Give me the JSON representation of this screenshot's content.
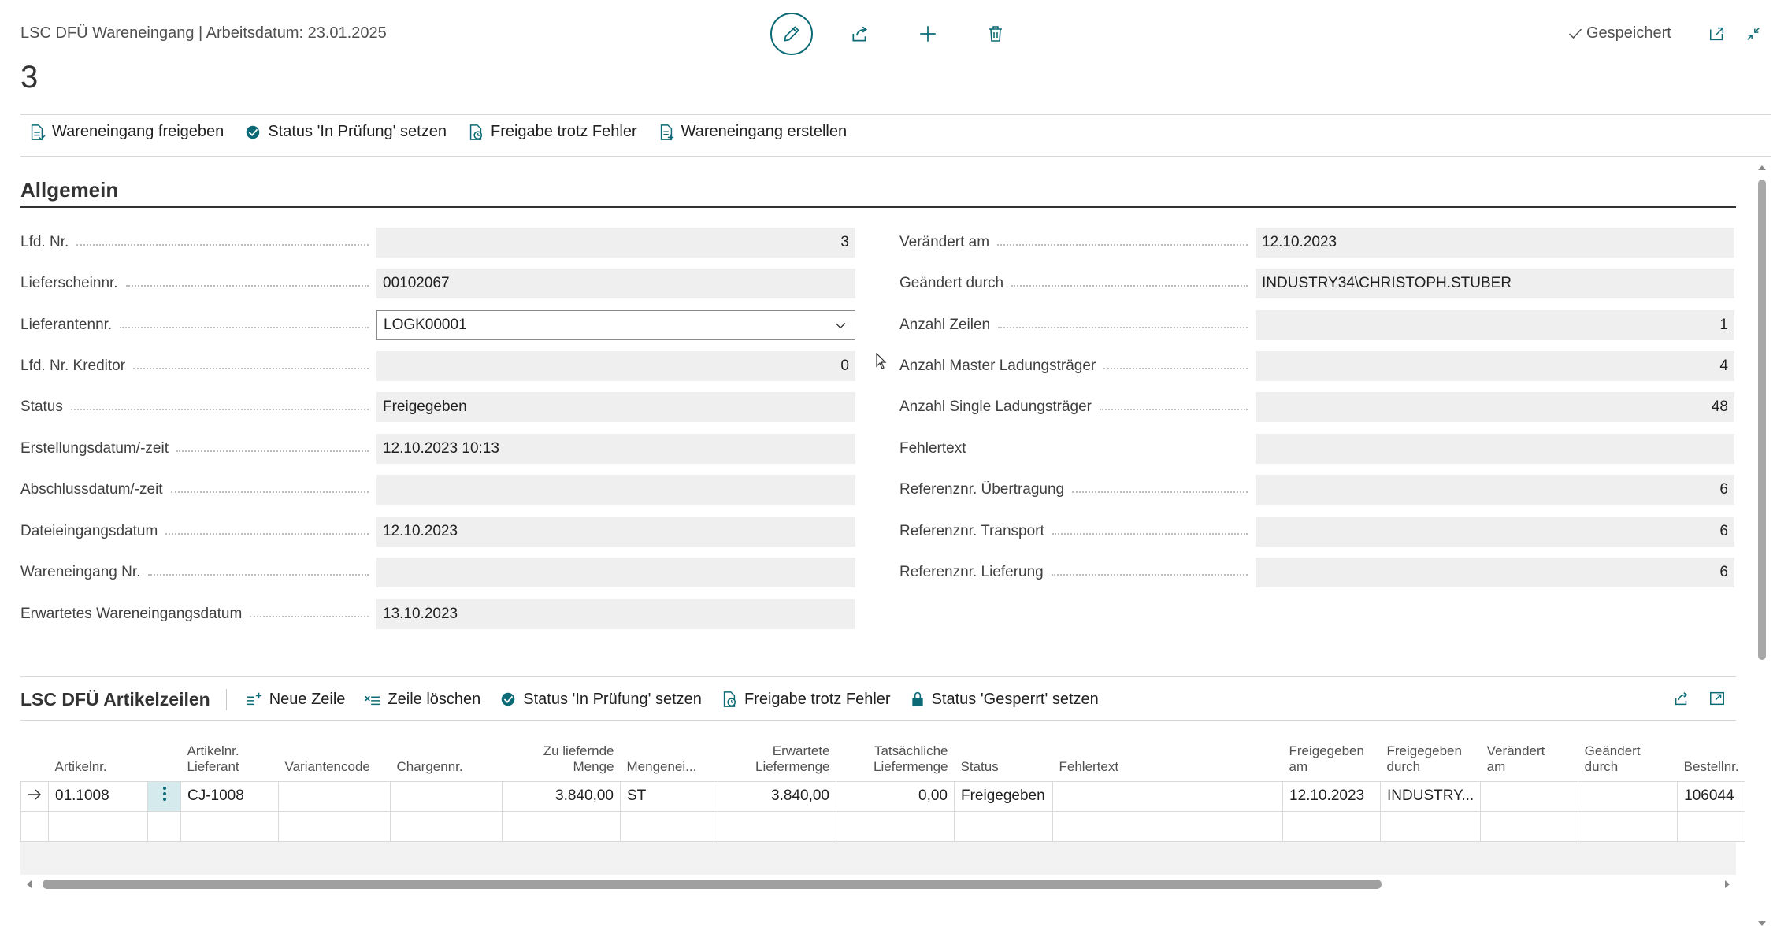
{
  "header": {
    "caption": "LSC DFÜ Wareneingang | Arbeitsdatum: 23.01.2025",
    "record_no": "3",
    "saved_label": "Gespeichert"
  },
  "actions": [
    {
      "label": "Wareneingang freigeben",
      "icon": "document-release-icon"
    },
    {
      "label": "Status 'In Prüfung' setzen",
      "icon": "check-badge-icon"
    },
    {
      "label": "Freigabe trotz Fehler",
      "icon": "document-warning-icon"
    },
    {
      "label": "Wareneingang erstellen",
      "icon": "document-create-icon"
    }
  ],
  "section": {
    "title": "Allgemein",
    "left_fields": [
      {
        "label": "Lfd. Nr.",
        "value": "3"
      },
      {
        "label": "Lieferscheinnr.",
        "value": "00102067"
      },
      {
        "label": "Lieferantennr.",
        "value": "LOGK00001"
      },
      {
        "label": "Lfd. Nr. Kreditor",
        "value": "0"
      },
      {
        "label": "Status",
        "value": "Freigegeben"
      },
      {
        "label": "Erstellungsdatum/-zeit",
        "value": "12.10.2023 10:13"
      },
      {
        "label": "Abschlussdatum/-zeit",
        "value": ""
      },
      {
        "label": "Dateieingangsdatum",
        "value": "12.10.2023"
      },
      {
        "label": "Wareneingang Nr.",
        "value": ""
      },
      {
        "label": "Erwartetes Wareneingangsdatum",
        "value": "13.10.2023"
      }
    ],
    "right_fields": [
      {
        "label": "Verändert am",
        "value": "12.10.2023"
      },
      {
        "label": "Geändert durch",
        "value": "INDUSTRY34\\CHRISTOPH.STUBER"
      },
      {
        "label": "Anzahl Zeilen",
        "value": "1"
      },
      {
        "label": "Anzahl Master Ladungsträger",
        "value": "4"
      },
      {
        "label": "Anzahl Single Ladungsträger",
        "value": "48"
      },
      {
        "label": "Fehlertext",
        "value": ""
      },
      {
        "label": "Referenznr. Übertragung",
        "value": "6"
      },
      {
        "label": "Referenznr. Transport",
        "value": "6"
      },
      {
        "label": "Referenznr. Lieferung",
        "value": "6"
      }
    ]
  },
  "subpage": {
    "title": "LSC DFÜ Artikelzeilen",
    "actions": [
      {
        "label": "Neue Zeile",
        "icon": "new-line-icon"
      },
      {
        "label": "Zeile löschen",
        "icon": "delete-line-icon"
      },
      {
        "label": "Status 'In Prüfung' setzen",
        "icon": "check-badge-icon"
      },
      {
        "label": "Freigabe trotz Fehler",
        "icon": "document-warning-icon"
      },
      {
        "label": "Status 'Gesperrt' setzen",
        "icon": "lock-icon"
      }
    ],
    "columns": [
      {
        "l1": "Artikelnr.",
        "l2": ""
      },
      {
        "l1": "Artikelnr.",
        "l2": "Lieferant"
      },
      {
        "l1": "Variantencode",
        "l2": ""
      },
      {
        "l1": "Chargennr.",
        "l2": ""
      },
      {
        "l1": "Zu liefernde",
        "l2": "Menge"
      },
      {
        "l1": "Mengenei...",
        "l2": ""
      },
      {
        "l1": "Erwartete",
        "l2": "Liefermenge"
      },
      {
        "l1": "Tatsächliche",
        "l2": "Liefermenge"
      },
      {
        "l1": "Status",
        "l2": ""
      },
      {
        "l1": "Fehlertext",
        "l2": ""
      },
      {
        "l1": "Freigegeben",
        "l2": "am"
      },
      {
        "l1": "Freigegeben",
        "l2": "durch"
      },
      {
        "l1": "Verändert",
        "l2": "am"
      },
      {
        "l1": "Geändert",
        "l2": "durch"
      },
      {
        "l1": "Bestellnr.",
        "l2": ""
      }
    ],
    "row": {
      "artikelnr": "01.1008",
      "artikelnr_lieferant": "CJ-1008",
      "variantencode": "",
      "chargennr": "",
      "zu_liefernde_menge": "3.840,00",
      "mengeneinheit": "ST",
      "erwartete_liefermenge": "3.840,00",
      "tatsaechliche_liefermenge": "0,00",
      "status": "Freigegeben",
      "fehlertext": "",
      "freigegeben_am": "12.10.2023",
      "freigegeben_durch": "INDUSTRY...",
      "veraendert_am": "",
      "geaendert_durch": "",
      "bestellnr": "106044"
    }
  },
  "colors": {
    "accent": "#0b6a75",
    "field_bg": "#efefef",
    "row_select": "#d4eaed"
  }
}
